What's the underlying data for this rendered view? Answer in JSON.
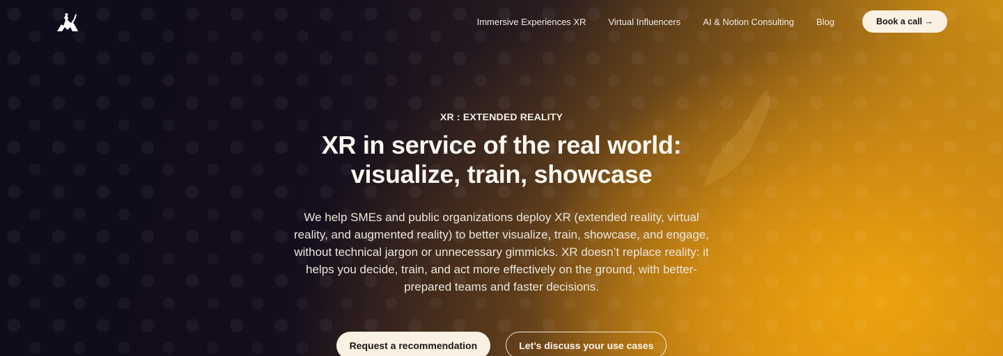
{
  "header": {
    "logo_icon": "knight-figure-logo-icon",
    "nav": [
      {
        "label": "Immersive Experiences XR"
      },
      {
        "label": "Virtual Influencers"
      },
      {
        "label": "AI & Notion Consulting"
      },
      {
        "label": "Blog"
      }
    ],
    "book_call": "Book a call →"
  },
  "hero": {
    "eyebrow": "XR : EXTENDED REALITY",
    "title_line1": "XR in service of the real world:",
    "title_line2": "visualize, train, showcase",
    "description": "We help SMEs and public organizations deploy XR (extended reality, virtual reality, and augmented reality) to better visualize, train, showcase, and engage, without technical jargon or unnecessary gimmicks. XR doesn’t replace reality: it helps you decide, train, and act more effectively on the ground, with better-prepared teams and faster decisions.",
    "cta_primary": "Request a recommendation",
    "cta_secondary": "Let’s discuss your use cases"
  },
  "colors": {
    "background_dark": "#110c1c",
    "accent_gold": "#e2a014",
    "button_cream": "#fbf1e2"
  }
}
